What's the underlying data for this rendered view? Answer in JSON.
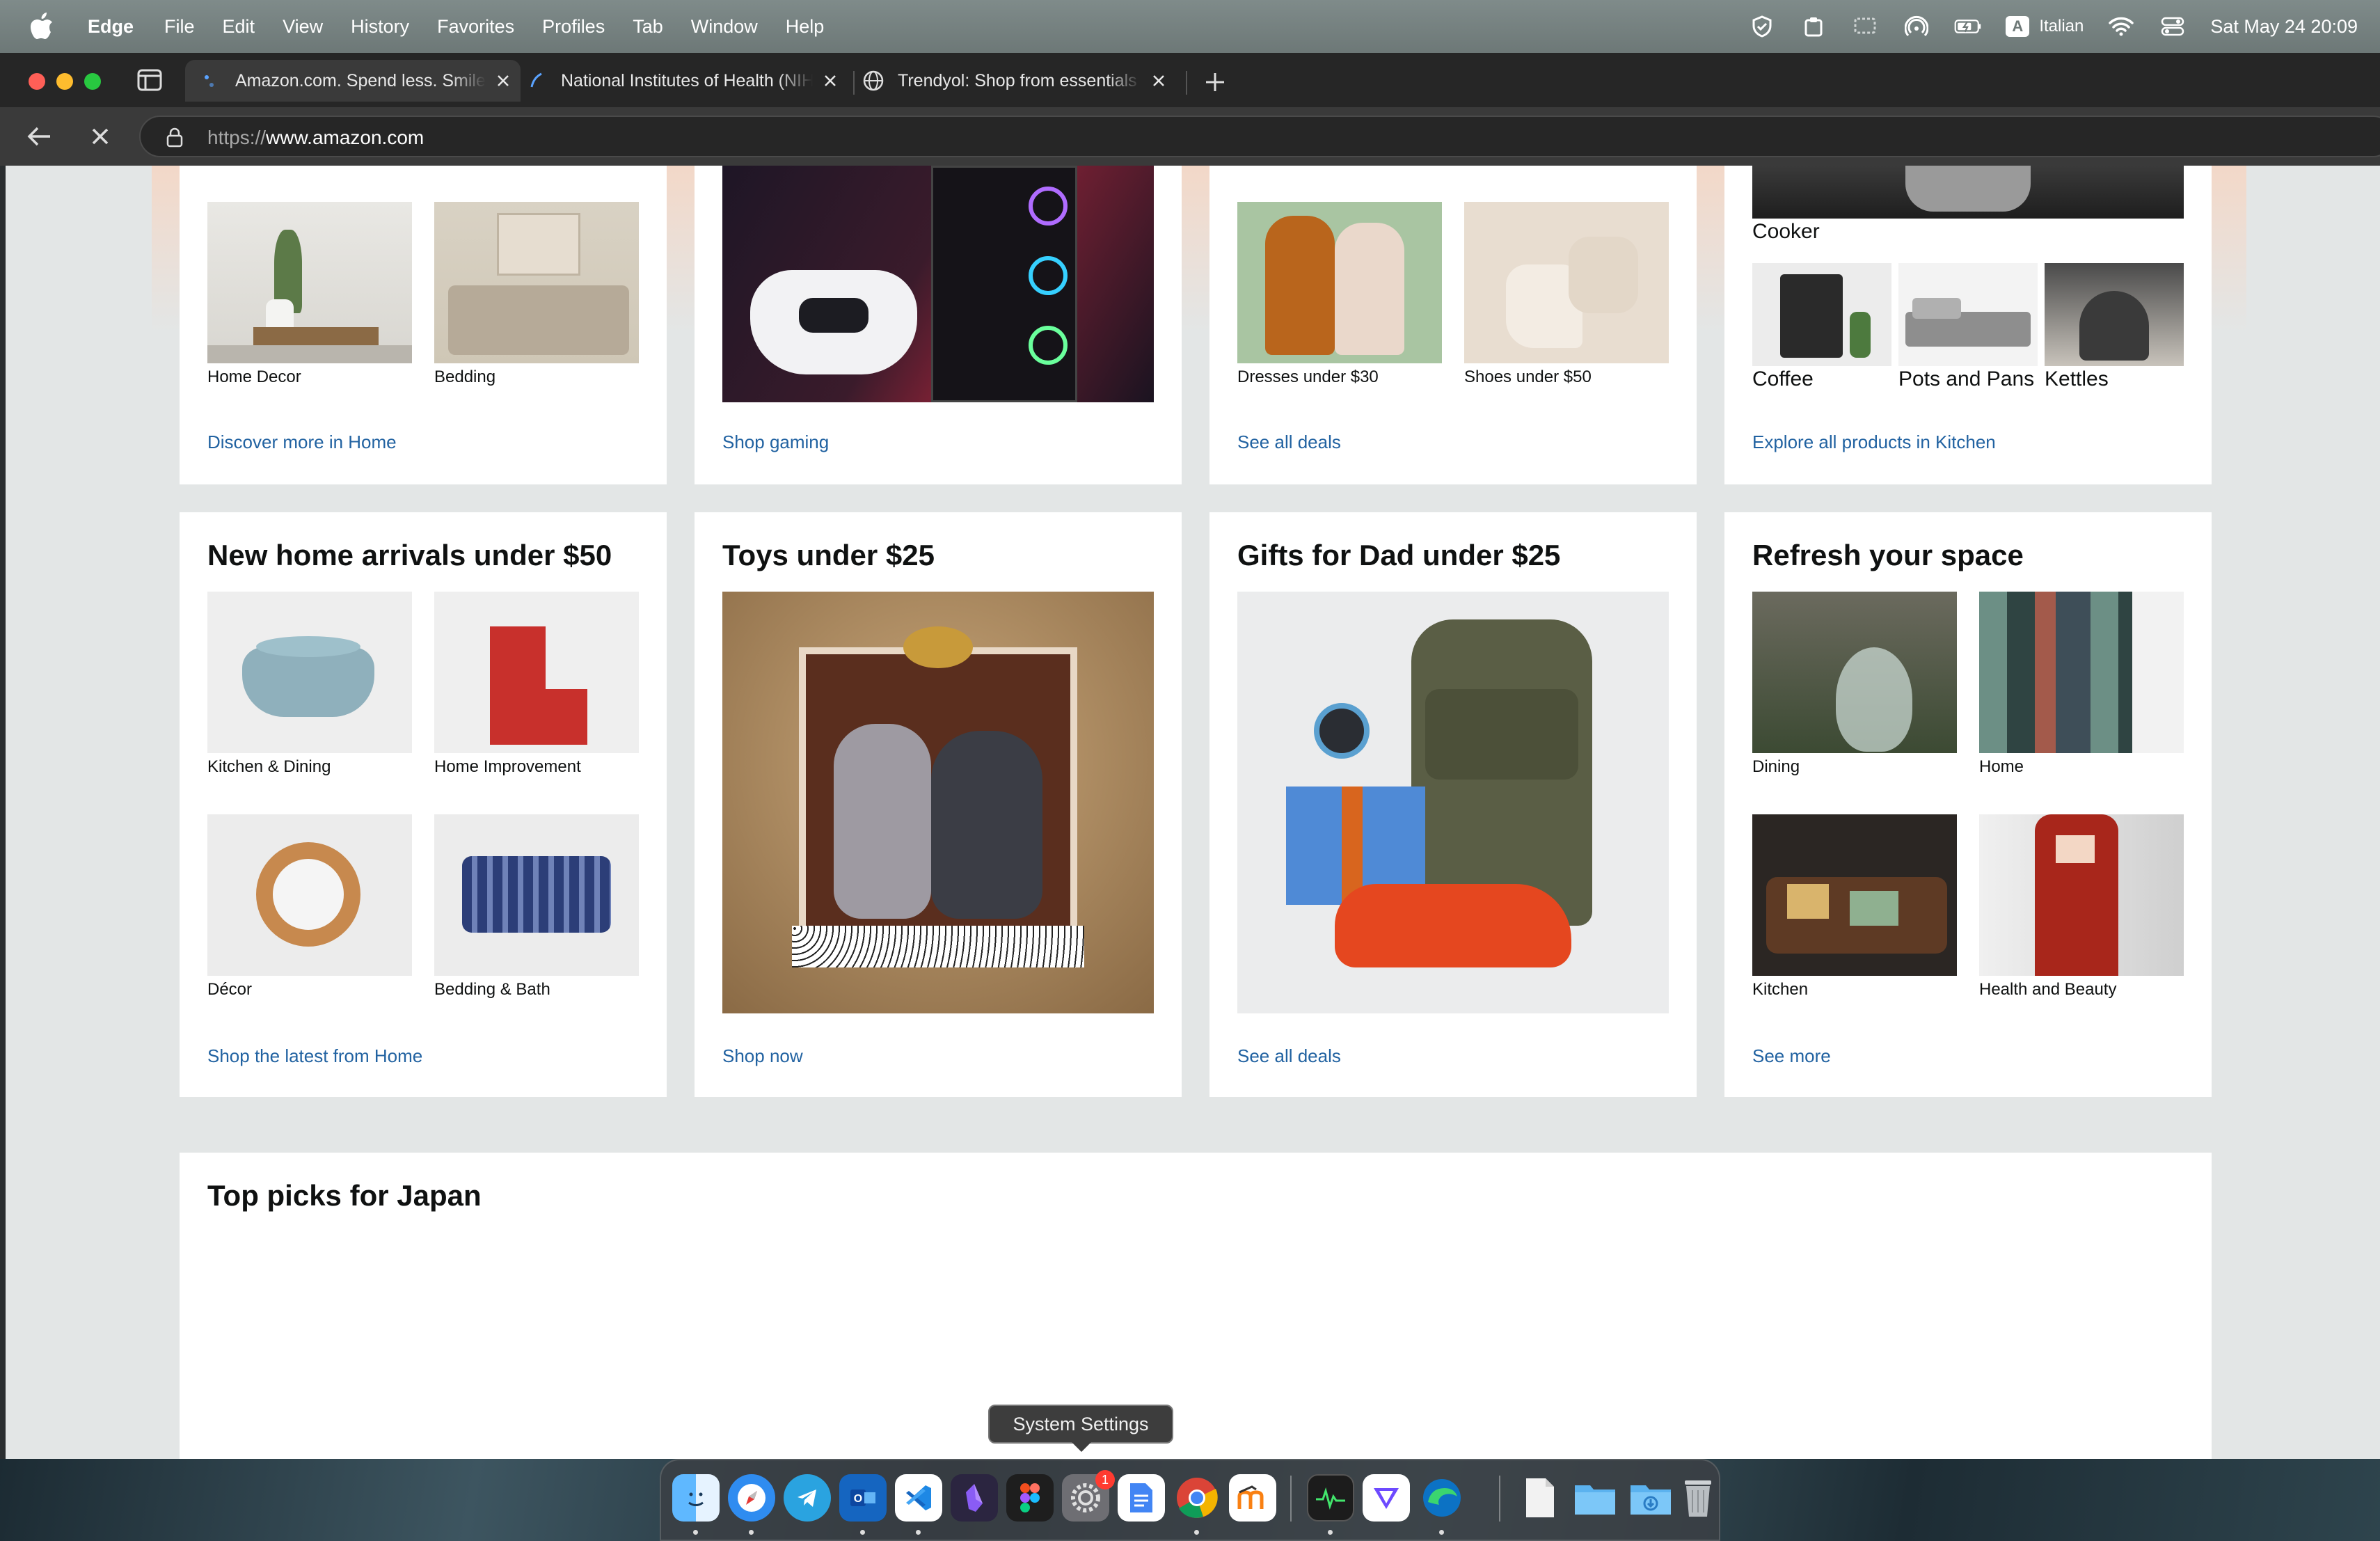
{
  "menubar": {
    "app_name": "Edge",
    "items": [
      "File",
      "Edit",
      "View",
      "History",
      "Favorites",
      "Profiles",
      "Tab",
      "Window",
      "Help"
    ],
    "input_source_badge": "A",
    "input_source": "Italian",
    "clock": "Sat May 24  20:09",
    "icons": [
      "apple-icon",
      "vpn-shield-icon",
      "clipboard-icon",
      "screen-mirror-icon",
      "airdrop-icon",
      "battery-icon",
      "wifi-icon",
      "control-center-icon"
    ]
  },
  "tabs": [
    {
      "title": "Amazon.com. Spend less. Smile more.",
      "icon": "amazon-loading-icon",
      "active": true
    },
    {
      "title": "National Institutes of Health (NIH)",
      "icon": "nih-icon",
      "active": false
    },
    {
      "title": "Trendyol: Shop from essentials",
      "icon": "globe-icon",
      "active": false
    }
  ],
  "address_bar": {
    "protocol": "https://",
    "host": "www.amazon.com"
  },
  "page": {
    "row1": [
      {
        "tiles": [
          "Home Decor",
          "Bedding"
        ],
        "link": "Discover more in Home"
      },
      {
        "link": "Shop gaming"
      },
      {
        "tiles": [
          "Dresses under $30",
          "Shoes under $50"
        ],
        "link": "See all deals"
      },
      {
        "feature_caption": "Cooker",
        "tiles": [
          "Coffee",
          "Pots and Pans",
          "Kettles"
        ],
        "link": "Explore all products in Kitchen"
      }
    ],
    "row2": [
      {
        "title": "New home arrivals under $50",
        "tiles": [
          "Kitchen & Dining",
          "Home Improvement",
          "Décor",
          "Bedding & Bath"
        ],
        "link": "Shop the latest from Home"
      },
      {
        "title": "Toys under $25",
        "link": "Shop now"
      },
      {
        "title": "Gifts for Dad under $25",
        "link": "See all deals"
      },
      {
        "title": "Refresh your space",
        "tiles": [
          "Dining",
          "Home",
          "Kitchen",
          "Health and Beauty"
        ],
        "link": "See more"
      }
    ],
    "top_picks_title": "Top picks for Japan"
  },
  "dock": {
    "tooltip": "System Settings",
    "settings_badge": "1",
    "apps": [
      "finder",
      "safari",
      "telegram",
      "outlook",
      "vscode",
      "obsidian",
      "figma",
      "system-settings",
      "docs",
      "chrome",
      "moodle",
      "activity-monitor",
      "proton-vpn",
      "edge",
      "documents-folder",
      "folder",
      "downloads-folder",
      "trash"
    ]
  },
  "colors": {
    "link": "#2162a1",
    "page_bg": "#e3e6e6",
    "menubar": "#6d7877",
    "tab_bar": "#262626"
  }
}
